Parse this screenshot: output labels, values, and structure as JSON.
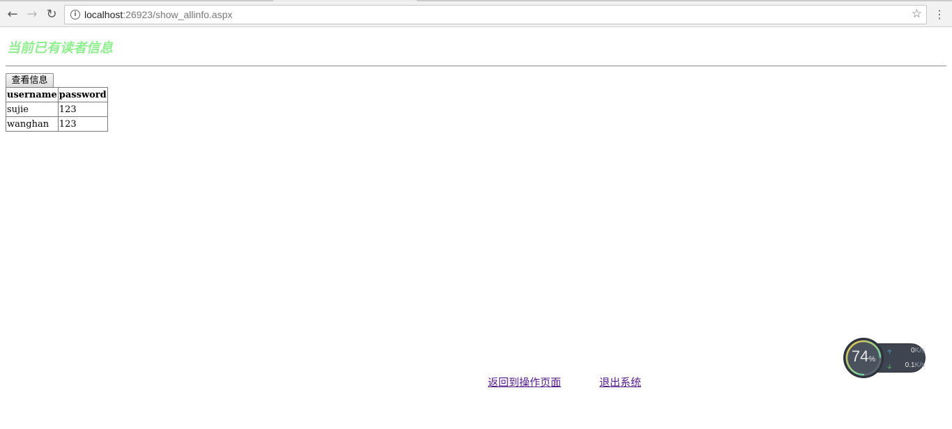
{
  "browser": {
    "url_host": "localhost",
    "url_rest": ":26923/show_allinfo.aspx"
  },
  "page": {
    "title": "当前已有读者信息",
    "view_button_label": "查看信息",
    "table": {
      "columns": [
        "username",
        "password"
      ],
      "rows": [
        [
          "sujie",
          "123"
        ],
        [
          "wanghan",
          "123"
        ]
      ]
    },
    "links": {
      "return": "返回到操作页面",
      "exit": "退出系统"
    }
  },
  "monitor": {
    "cpu_value": "74",
    "cpu_unit": "%",
    "cpu_level": 0.74,
    "upload_value": "0",
    "upload_unit": "K/s",
    "download_value": "0.1",
    "download_unit": "K/s",
    "colors": {
      "ring_start": "#f5c542",
      "ring_end": "#3fd8c8",
      "background": "#3e4550"
    }
  }
}
